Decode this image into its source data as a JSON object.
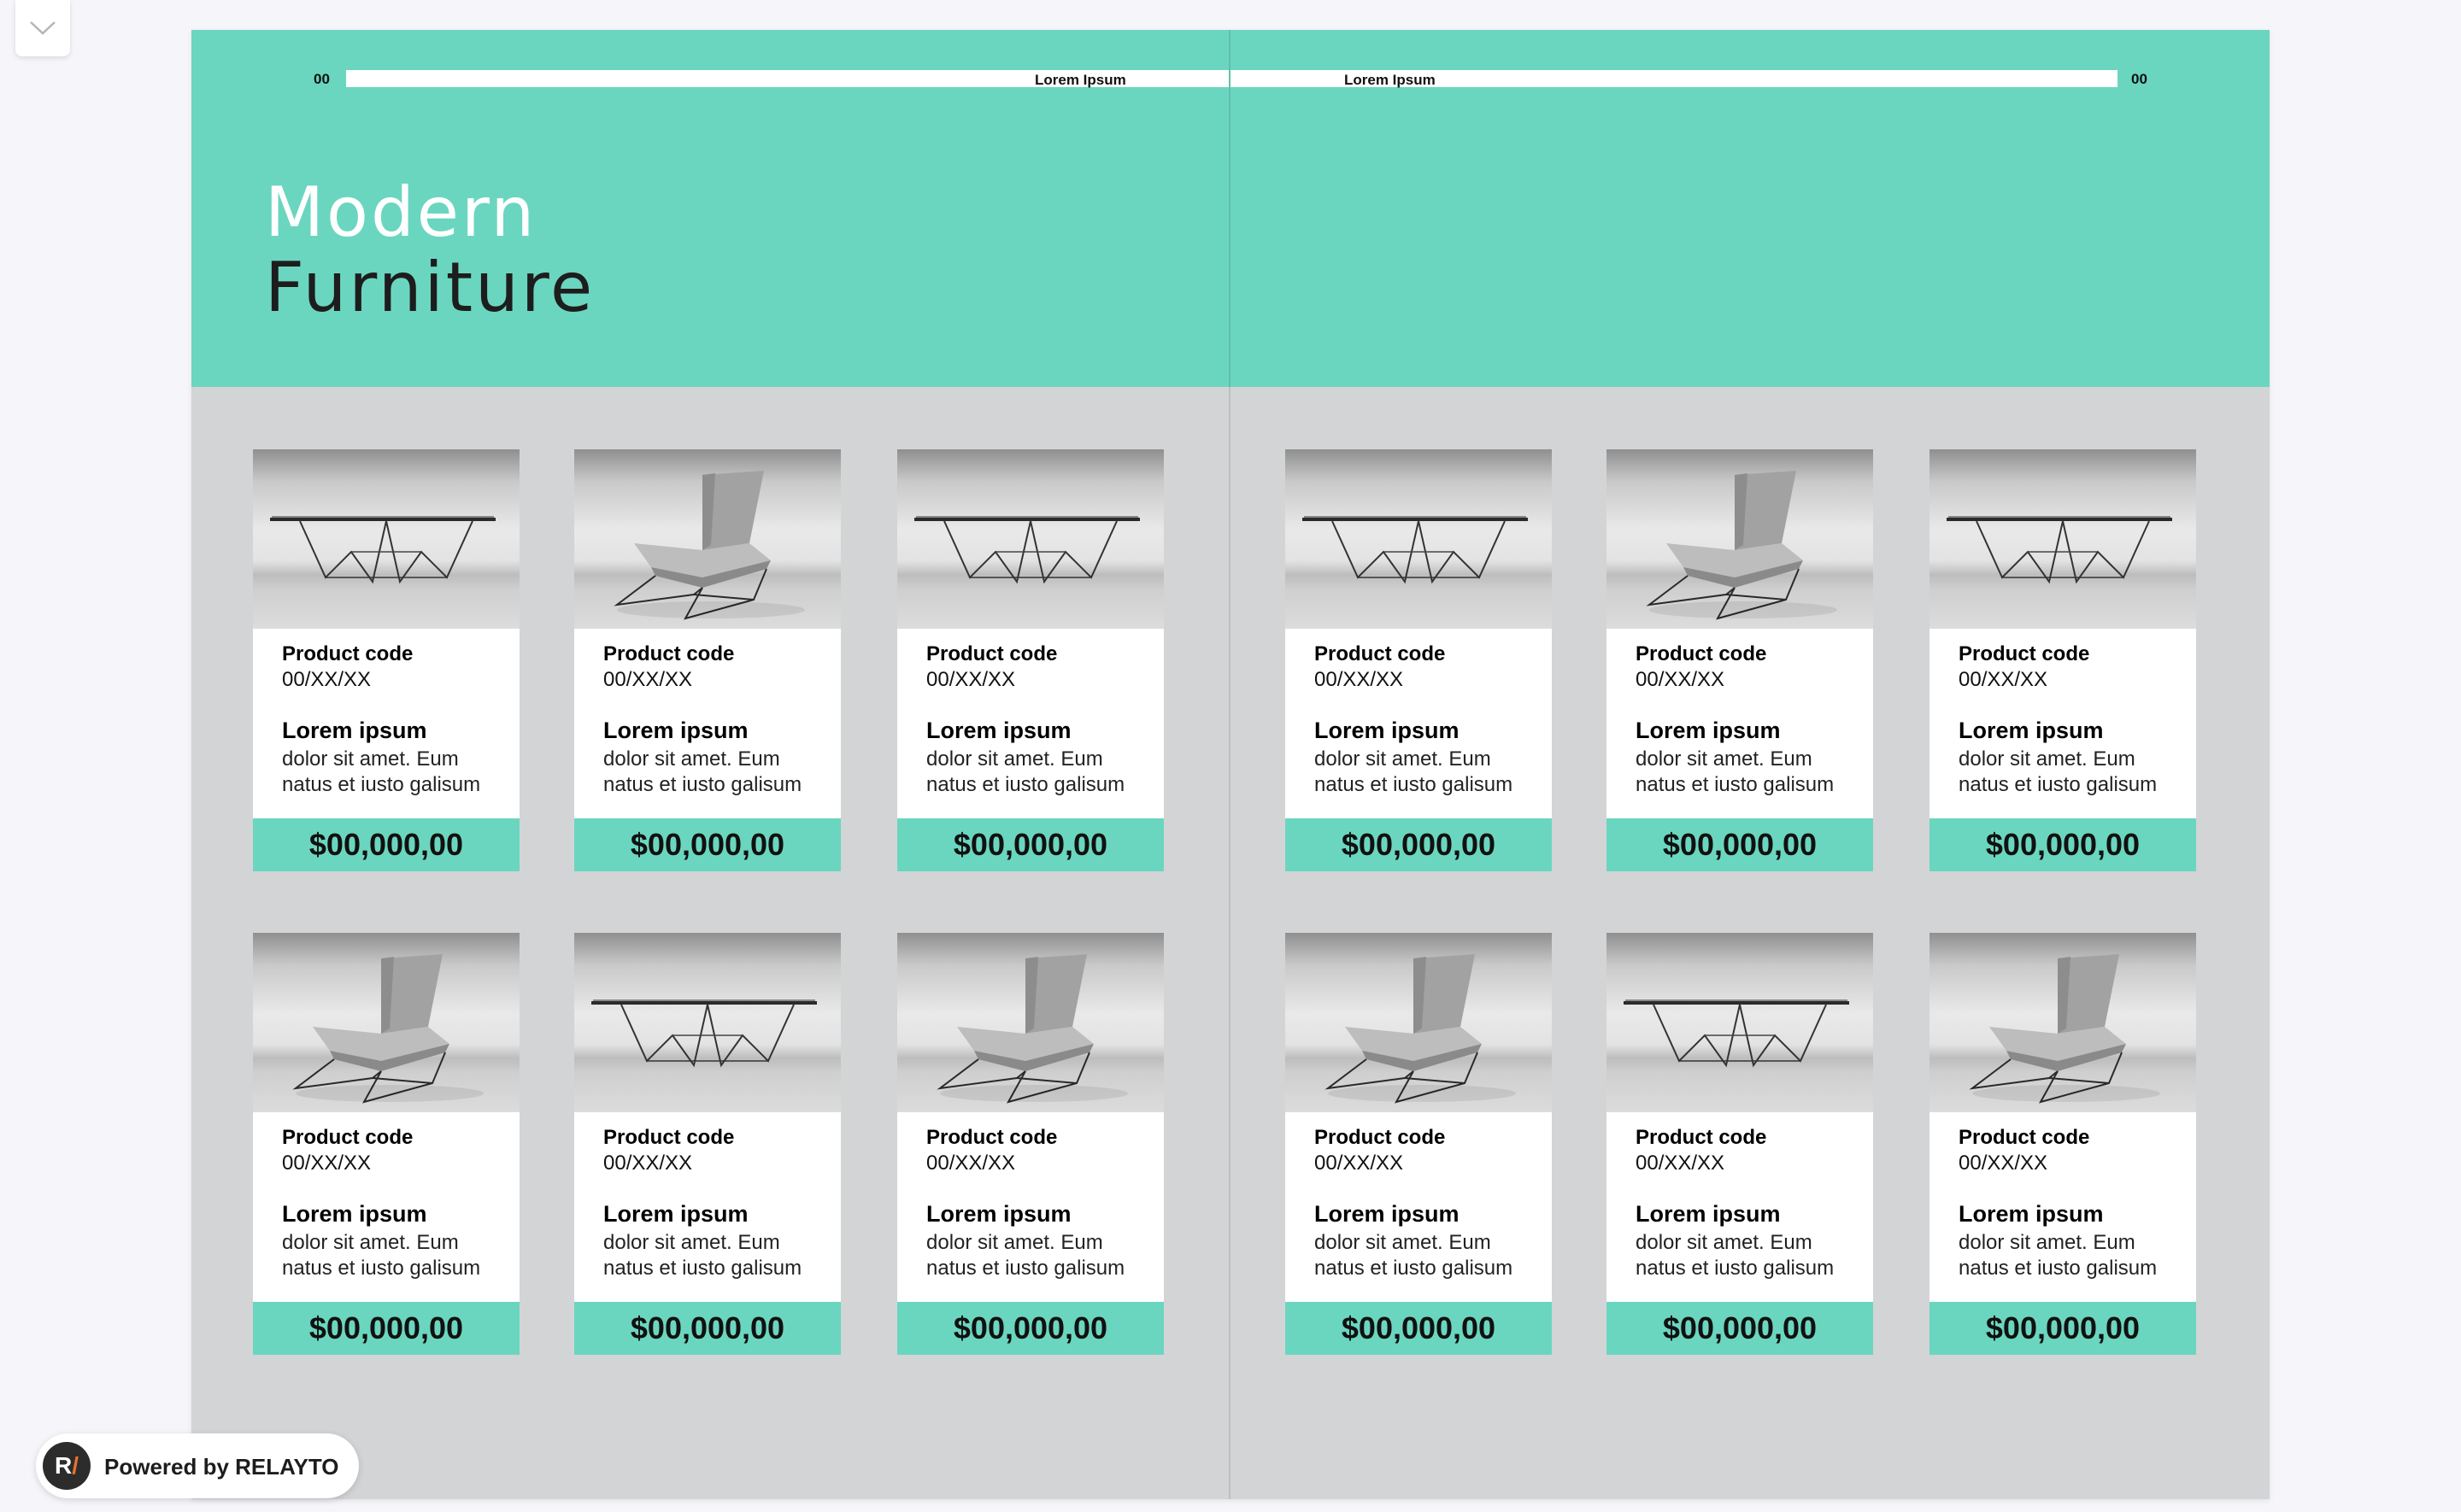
{
  "header": {
    "page_number_left": "00",
    "page_number_right": "00",
    "bar_label_left": "Lorem Ipsum",
    "bar_label_right": "Lorem Ipsum",
    "title_line1": "Modern",
    "title_line2": "Furniture"
  },
  "products": [
    {
      "image": "table",
      "code_label": "Product code",
      "code": "00/XX/XX",
      "name": "Lorem ipsum",
      "desc": "dolor sit amet. Eum natus et iusto galisum",
      "price": "$00,000,00"
    },
    {
      "image": "chair",
      "code_label": "Product code",
      "code": "00/XX/XX",
      "name": "Lorem ipsum",
      "desc": "dolor sit amet. Eum natus et iusto galisum",
      "price": "$00,000,00"
    },
    {
      "image": "table",
      "code_label": "Product code",
      "code": "00/XX/XX",
      "name": "Lorem ipsum",
      "desc": "dolor sit amet. Eum natus et iusto galisum",
      "price": "$00,000,00"
    },
    {
      "image": "table",
      "code_label": "Product code",
      "code": "00/XX/XX",
      "name": "Lorem ipsum",
      "desc": "dolor sit amet. Eum natus et iusto galisum",
      "price": "$00,000,00"
    },
    {
      "image": "chair",
      "code_label": "Product code",
      "code": "00/XX/XX",
      "name": "Lorem ipsum",
      "desc": "dolor sit amet. Eum natus et iusto galisum",
      "price": "$00,000,00"
    },
    {
      "image": "table",
      "code_label": "Product code",
      "code": "00/XX/XX",
      "name": "Lorem ipsum",
      "desc": "dolor sit amet. Eum natus et iusto galisum",
      "price": "$00,000,00"
    },
    {
      "image": "chair",
      "code_label": "Product code",
      "code": "00/XX/XX",
      "name": "Lorem ipsum",
      "desc": "dolor sit amet. Eum natus et iusto galisum",
      "price": "$00,000,00"
    },
    {
      "image": "table",
      "code_label": "Product code",
      "code": "00/XX/XX",
      "name": "Lorem ipsum",
      "desc": "dolor sit amet. Eum natus et iusto galisum",
      "price": "$00,000,00"
    },
    {
      "image": "chair",
      "code_label": "Product code",
      "code": "00/XX/XX",
      "name": "Lorem ipsum",
      "desc": "dolor sit amet. Eum natus et iusto galisum",
      "price": "$00,000,00"
    },
    {
      "image": "chair",
      "code_label": "Product code",
      "code": "00/XX/XX",
      "name": "Lorem ipsum",
      "desc": "dolor sit amet. Eum natus et iusto galisum",
      "price": "$00,000,00"
    },
    {
      "image": "table",
      "code_label": "Product code",
      "code": "00/XX/XX",
      "name": "Lorem ipsum",
      "desc": "dolor sit amet. Eum natus et iusto galisum",
      "price": "$00,000,00"
    },
    {
      "image": "chair",
      "code_label": "Product code",
      "code": "00/XX/XX",
      "name": "Lorem ipsum",
      "desc": "dolor sit amet. Eum natus et iusto galisum",
      "price": "$00,000,00"
    }
  ],
  "branding": {
    "powered_by": "Powered by RELAYTO",
    "logo_letter": "R",
    "logo_slash": "/"
  },
  "icons": {
    "collapse": "chevron-down-icon"
  },
  "colors": {
    "accent": "#6bd6bf",
    "spread_background": "#d3d4d6",
    "page_background": "#f6f5f9",
    "logo_accent": "#e8732c"
  }
}
